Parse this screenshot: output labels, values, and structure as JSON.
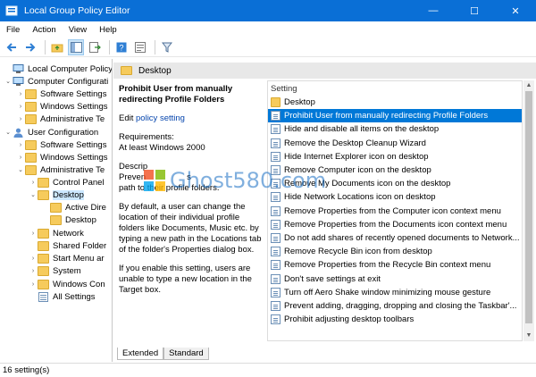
{
  "window": {
    "title": "Local Group Policy Editor",
    "minimize": "—",
    "maximize": "☐",
    "close": "✕"
  },
  "menu": [
    "File",
    "Action",
    "View",
    "Help"
  ],
  "toolbar": [
    "back-icon",
    "forward-icon",
    "up-folder-icon",
    "show-hide-tree-icon",
    "export-list-icon",
    "help-icon",
    "properties-icon",
    "filter-icon"
  ],
  "tree": [
    {
      "label": "Local Computer Policy",
      "toggle": "",
      "icon": "computer-icon"
    },
    {
      "label": "Computer Configurati",
      "toggle": "⌄",
      "icon": "computer-icon"
    },
    {
      "label": "Software Settings",
      "toggle": "›",
      "icon": "folder-icon"
    },
    {
      "label": "Windows Settings",
      "toggle": "›",
      "icon": "folder-icon"
    },
    {
      "label": "Administrative Te",
      "toggle": "›",
      "icon": "folder-icon"
    },
    {
      "label": "User Configuration",
      "toggle": "⌄",
      "icon": "user-icon"
    },
    {
      "label": "Software Settings",
      "toggle": "›",
      "icon": "folder-icon"
    },
    {
      "label": "Windows Settings",
      "toggle": "›",
      "icon": "folder-icon"
    },
    {
      "label": "Administrative Te",
      "toggle": "⌄",
      "icon": "folder-icon"
    },
    {
      "label": "Control Panel",
      "toggle": "›",
      "icon": "folder-icon"
    },
    {
      "label": "Desktop",
      "toggle": "⌄",
      "icon": "folder-icon",
      "selected": true
    },
    {
      "label": "Active Dire",
      "toggle": "",
      "icon": "folder-icon"
    },
    {
      "label": "Desktop",
      "toggle": "",
      "icon": "folder-icon"
    },
    {
      "label": "Network",
      "toggle": "›",
      "icon": "folder-icon"
    },
    {
      "label": "Shared Folder",
      "toggle": "",
      "icon": "folder-icon"
    },
    {
      "label": "Start Menu ar",
      "toggle": "›",
      "icon": "folder-icon"
    },
    {
      "label": "System",
      "toggle": "›",
      "icon": "folder-icon"
    },
    {
      "label": "Windows Con",
      "toggle": "›",
      "icon": "folder-icon"
    },
    {
      "label": "All Settings",
      "toggle": "",
      "icon": "settings-icon"
    }
  ],
  "panel": {
    "header": "Desktop"
  },
  "description": {
    "title": "Prohibit User from manually redirecting Profile Folders",
    "edit_prefix": "Edit ",
    "edit_link": "policy setting",
    "requirements_label": "Requirements:",
    "requirements_value": "At least Windows 2000",
    "description_label": "Descrip",
    "description_line1": "Preven",
    "description_line1_tail": "s",
    "description_line2": "path to their profile folders.",
    "para2": "By default, a user can change the location of their individual profile folders like Documents, Music etc. by typing a new path in the Locations tab of the folder's Properties dialog box.",
    "para3": "If you enable this setting, users are unable to type a new location in the Target box."
  },
  "settings": {
    "column_header": "Setting",
    "rows": [
      {
        "label": "Desktop",
        "type": "folder"
      },
      {
        "label": "Prohibit User from manually redirecting Profile Folders",
        "type": "policy",
        "selected": true
      },
      {
        "label": "Hide and disable all items on the desktop",
        "type": "policy"
      },
      {
        "label": "Remove the Desktop Cleanup Wizard",
        "type": "policy"
      },
      {
        "label": "Hide Internet Explorer icon on desktop",
        "type": "policy"
      },
      {
        "label": "Remove Computer icon on the desktop",
        "type": "policy"
      },
      {
        "label": "Remove My Documents icon on the desktop",
        "type": "policy"
      },
      {
        "label": "Hide Network Locations icon on desktop",
        "type": "policy"
      },
      {
        "label": "Remove Properties from the Computer icon context menu",
        "type": "policy"
      },
      {
        "label": "Remove Properties from the Documents icon context menu",
        "type": "policy"
      },
      {
        "label": "Do not add shares of recently opened documents to Network...",
        "type": "policy"
      },
      {
        "label": "Remove Recycle Bin icon from desktop",
        "type": "policy"
      },
      {
        "label": "Remove Properties from the Recycle Bin context menu",
        "type": "policy"
      },
      {
        "label": "Don't save settings at exit",
        "type": "policy"
      },
      {
        "label": "Turn off Aero Shake window minimizing mouse gesture",
        "type": "policy"
      },
      {
        "label": "Prevent adding, dragging, dropping and closing the Taskbar'...",
        "type": "policy"
      },
      {
        "label": "Prohibit adjusting desktop toolbars",
        "type": "policy"
      }
    ]
  },
  "tabs": [
    {
      "label": "Extended",
      "active": true
    },
    {
      "label": "Standard",
      "active": false
    }
  ],
  "status": {
    "text": "16 setting(s)"
  },
  "watermark": {
    "text": "Ghost580.com"
  },
  "colors": {
    "titlebar": "#0a6fd6",
    "selection": "#0078d7",
    "folder": "#f6cb5c",
    "link": "#0645ad"
  }
}
